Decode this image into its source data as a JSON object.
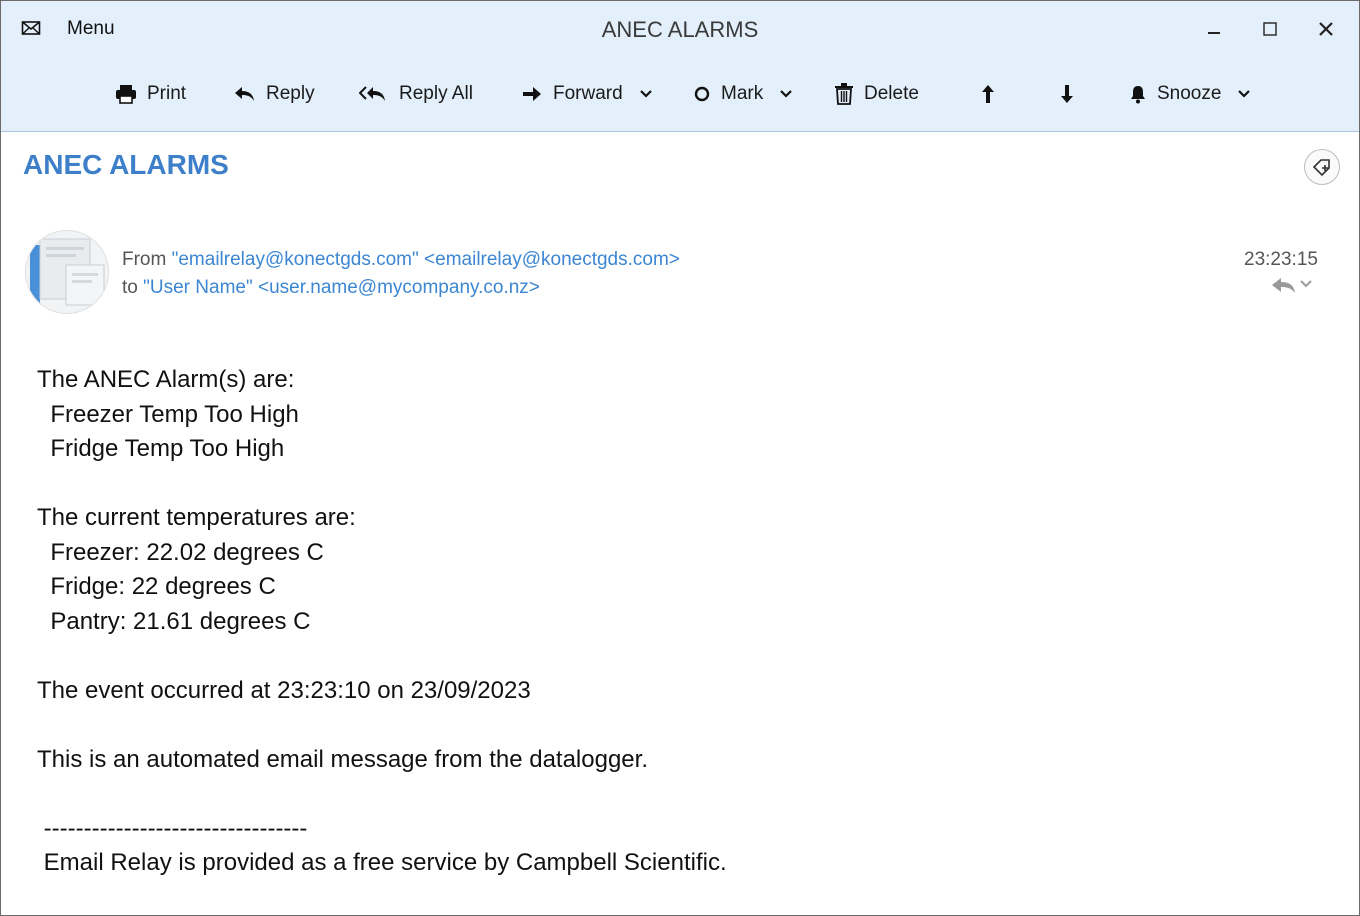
{
  "window": {
    "menu_label": "Menu",
    "title": "ANEC ALARMS"
  },
  "toolbar": {
    "print": "Print",
    "reply": "Reply",
    "reply_all": "Reply All",
    "forward": "Forward",
    "mark": "Mark",
    "delete": "Delete",
    "snooze": "Snooze"
  },
  "message": {
    "subject": "ANEC ALARMS",
    "from_label": "From",
    "from_value": "\"emailrelay@konectgds.com\" <emailrelay@konectgds.com>",
    "to_label": "to",
    "to_value": "\"User Name\" <user.name@mycompany.co.nz>",
    "time": "23:23:15",
    "body": {
      "line1": "The ANEC Alarm(s) are:",
      "line2": "  Freezer Temp Too High",
      "line3": "  Fridge Temp Too High",
      "line4": "The current temperatures are:",
      "line5": "  Freezer: 22.02 degrees C",
      "line6": "  Fridge: 22 degrees C",
      "line7": "  Pantry: 21.61 degrees C",
      "line8": "The event occurred at 23:23:10 on 23/09/2023",
      "line9": "This is an automated email message from the datalogger.",
      "line10": " ---------------------------------",
      "line11": " Email Relay is provided as a free service by Campbell Scientific."
    }
  },
  "icons": {
    "app": "envelope-icon",
    "print": "printer-icon",
    "reply": "reply-arrow-icon",
    "reply_all": "reply-all-arrow-icon",
    "forward": "forward-arrow-icon",
    "mark": "circle-icon",
    "delete": "trash-icon",
    "up": "arrow-up-icon",
    "down": "arrow-down-icon",
    "snooze": "bell-icon",
    "tag": "tag-add-icon"
  },
  "colors": {
    "chrome_bg": "#e3effb",
    "subject": "#3d7fc9",
    "link": "#3c86d2"
  }
}
